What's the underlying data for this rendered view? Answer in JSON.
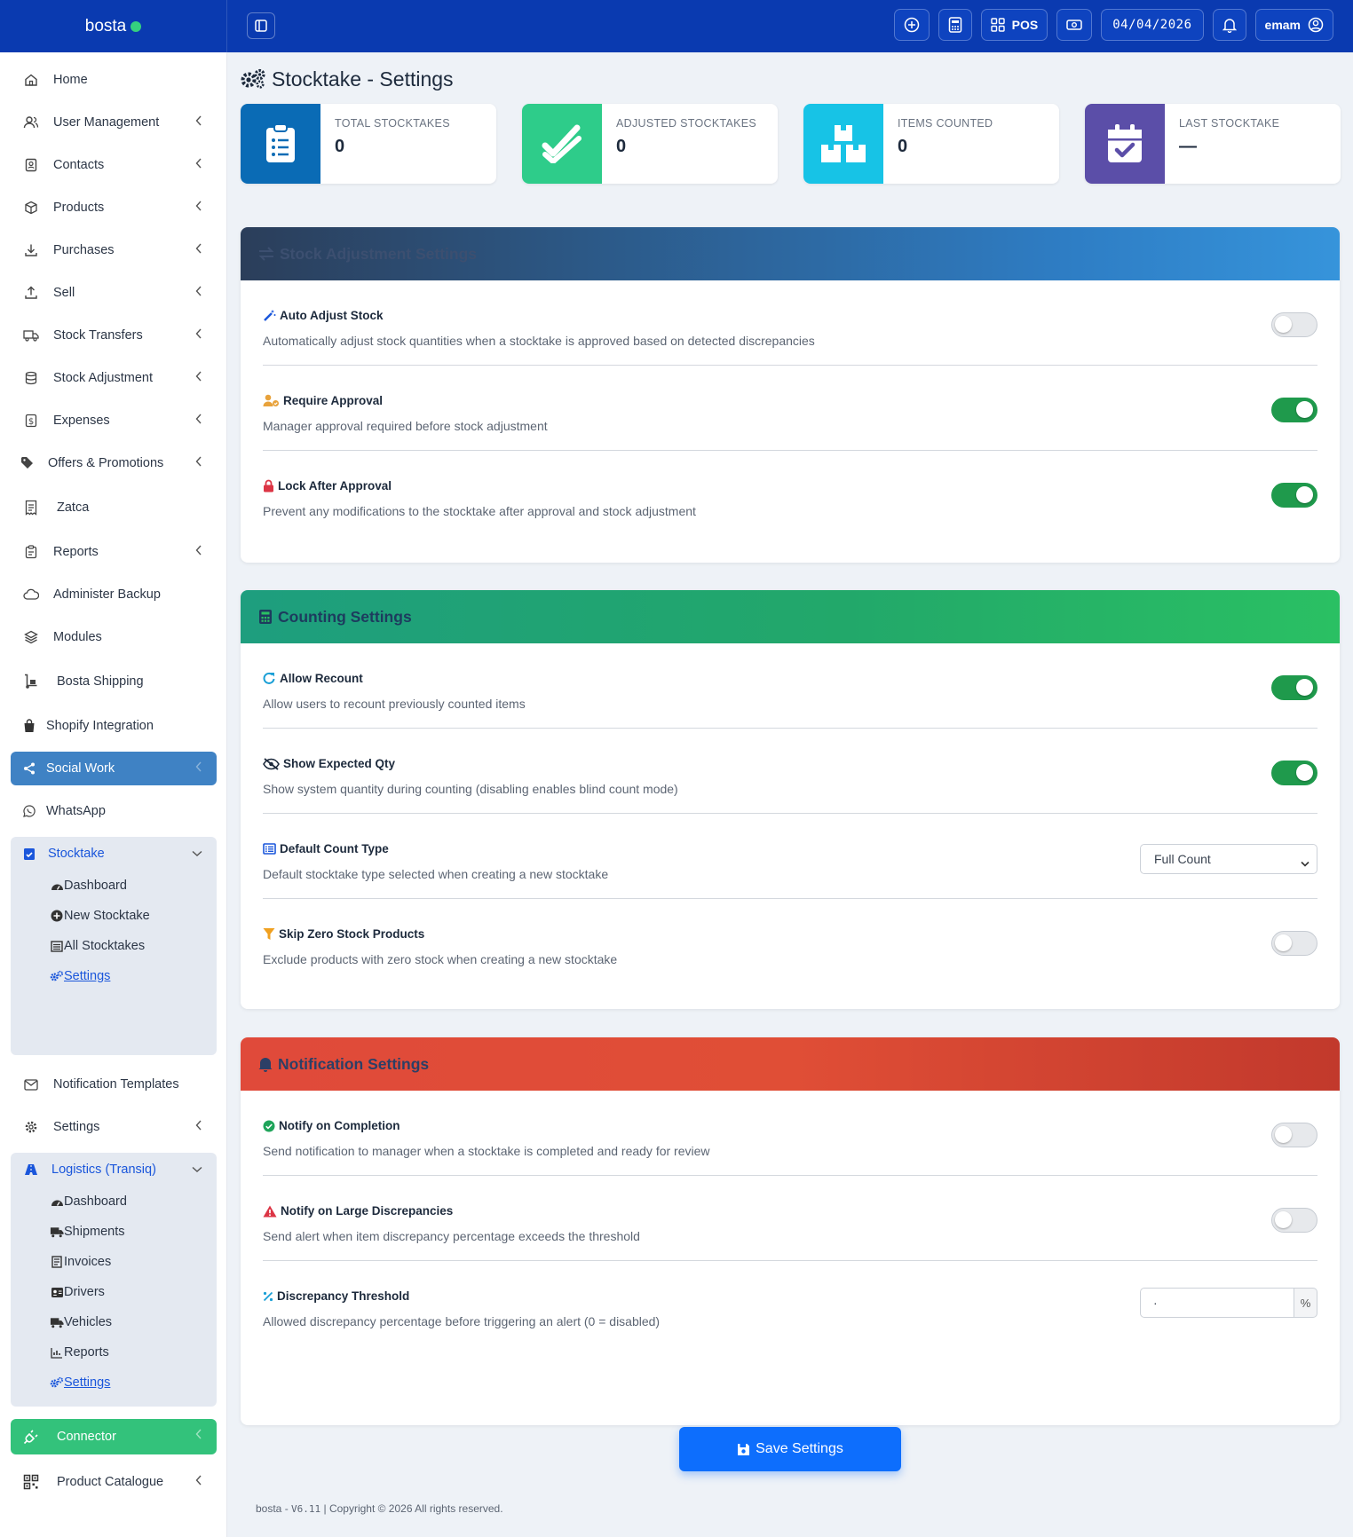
{
  "app": {
    "brand": "bosta",
    "accent": "#0a3ab0"
  },
  "topbar": {
    "pos_label": "POS",
    "date": "04/04/2026",
    "user": "emam"
  },
  "sidebar": {
    "items": [
      {
        "label": "Home",
        "icon": "home-icon"
      },
      {
        "label": "User Management",
        "icon": "users-icon"
      },
      {
        "label": "Contacts",
        "icon": "contacts-icon"
      },
      {
        "label": "Products",
        "icon": "box-icon"
      },
      {
        "label": "Purchases",
        "icon": "download-icon"
      },
      {
        "label": "Sell",
        "icon": "upload-icon"
      },
      {
        "label": "Stock Transfers",
        "icon": "truck-icon"
      },
      {
        "label": "Stock Adjustment",
        "icon": "database-icon"
      },
      {
        "label": "Expenses",
        "icon": "dollar-icon"
      },
      {
        "label": "Offers & Promotions",
        "icon": "tags-icon"
      },
      {
        "label": "Zatca",
        "icon": "receipt-icon"
      },
      {
        "label": "Reports",
        "icon": "clipboard-icon"
      },
      {
        "label": "Administer Backup",
        "icon": "cloud-icon"
      },
      {
        "label": "Modules",
        "icon": "layers-icon"
      },
      {
        "label": "Bosta Shipping",
        "icon": "dolly-icon"
      },
      {
        "label": "Shopify Integration",
        "icon": "bag-icon"
      },
      {
        "label": "Social Work",
        "icon": "share-icon"
      },
      {
        "label": "WhatsApp",
        "icon": "whatsapp-icon"
      },
      {
        "label": "Notification Templates",
        "icon": "envelope-icon"
      },
      {
        "label": "Settings",
        "icon": "gear-icon"
      },
      {
        "label": "Connector",
        "icon": "plug-icon"
      },
      {
        "label": "Product Catalogue",
        "icon": "qrcode-icon"
      }
    ],
    "stocktake": {
      "label": "Stocktake",
      "subs": [
        "Dashboard",
        "New Stocktake",
        "All Stocktakes",
        "Settings"
      ]
    },
    "logistics": {
      "label": "Logistics (Transiq)",
      "subs": [
        "Dashboard",
        "Shipments",
        "Invoices",
        "Drivers",
        "Vehicles",
        "Reports",
        "Settings"
      ]
    }
  },
  "page": {
    "title": "Stocktake - Settings"
  },
  "stats": [
    {
      "label": "TOTAL STOCKTAKES",
      "value": "0",
      "color": "#0a6bb5"
    },
    {
      "label": "ADJUSTED STOCKTAKES",
      "value": "0",
      "color": "#2ecc8a"
    },
    {
      "label": "ITEMS COUNTED",
      "value": "0",
      "color": "#17c3e6"
    },
    {
      "label": "LAST STOCKTAKE",
      "value": "—",
      "color": "#5b4ea8"
    }
  ],
  "sections": {
    "stock_adjustment": {
      "title": "Stock Adjustment Settings",
      "rows": [
        {
          "title": "Auto Adjust Stock",
          "desc": "Automatically adjust stock quantities when a stocktake is approved based on detected discrepancies",
          "enabled": false
        },
        {
          "title": "Require Approval",
          "desc": "Manager approval required before stock adjustment",
          "enabled": true
        },
        {
          "title": "Lock After Approval",
          "desc": "Prevent any modifications to the stocktake after approval and stock adjustment",
          "enabled": true
        }
      ]
    },
    "counting": {
      "title": "Counting Settings",
      "rows": [
        {
          "title": "Allow Recount",
          "desc": "Allow users to recount previously counted items",
          "enabled": true
        },
        {
          "title": "Show Expected Qty",
          "desc": "Show system quantity during counting (disabling enables blind count mode)",
          "enabled": true
        },
        {
          "title": "Default Count Type",
          "desc": "Default stocktake type selected when creating a new stocktake",
          "selected": "Full Count"
        },
        {
          "title": "Skip Zero Stock Products",
          "desc": "Exclude products with zero stock when creating a new stocktake",
          "enabled": false
        }
      ]
    },
    "notification": {
      "title": "Notification Settings",
      "rows": [
        {
          "title": "Notify on Completion",
          "desc": "Send notification to manager when a stocktake is completed and ready for review",
          "enabled": false
        },
        {
          "title": "Notify on Large Discrepancies",
          "desc": "Send alert when item discrepancy percentage exceeds the threshold",
          "enabled": false
        },
        {
          "title": "Discrepancy Threshold",
          "desc": "Allowed discrepancy percentage before triggering an alert (0 = disabled)",
          "value": "·",
          "unit": "%"
        }
      ]
    }
  },
  "save_label": "Save Settings",
  "footer": {
    "prefix": "bosta - ",
    "version": "V6.11",
    "suffix": " | Copyright © 2026 All rights reserved."
  }
}
